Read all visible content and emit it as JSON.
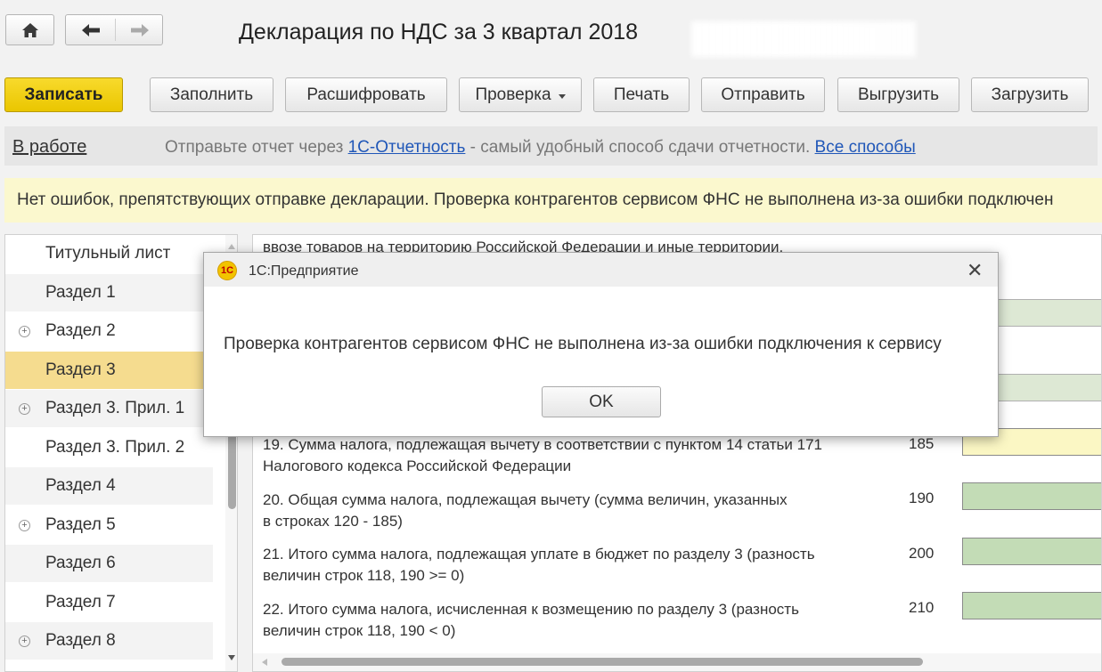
{
  "header": {
    "title": "Декларация по НДС за 3 квартал 2018"
  },
  "toolbar": {
    "save": "Записать",
    "fill": "Заполнить",
    "decode": "Расшифровать",
    "check": "Проверка",
    "print": "Печать",
    "send": "Отправить",
    "export": "Выгрузить",
    "import": "Загрузить"
  },
  "status": {
    "state_link": "В работе",
    "info_prefix": "Отправьте отчет через ",
    "info_link": "1С-Отчетность",
    "info_suffix": " - самый удобный способ сдачи отчетности. ",
    "all_methods_link": "Все способы"
  },
  "notice": {
    "text": "Нет ошибок, препятствующих отправке декларации. Проверка контрагентов сервисом ФНС не выполнена из-за ошибки подключен"
  },
  "sidebar": {
    "items": [
      {
        "label": "Титульный лист",
        "expandable": false,
        "selected": false
      },
      {
        "label": "Раздел 1",
        "expandable": false,
        "selected": false
      },
      {
        "label": "Раздел 2",
        "expandable": true,
        "selected": false
      },
      {
        "label": "Раздел 3",
        "expandable": false,
        "selected": true
      },
      {
        "label": "Раздел 3. Прил. 1",
        "expandable": true,
        "selected": false
      },
      {
        "label": "Раздел 3. Прил. 2",
        "expandable": false,
        "selected": false
      },
      {
        "label": "Раздел 4",
        "expandable": false,
        "selected": false
      },
      {
        "label": "Раздел 5",
        "expandable": true,
        "selected": false
      },
      {
        "label": "Раздел 6",
        "expandable": false,
        "selected": false
      },
      {
        "label": "Раздел 7",
        "expandable": false,
        "selected": false
      },
      {
        "label": "Раздел 8",
        "expandable": true,
        "selected": false
      }
    ]
  },
  "form": {
    "top_text": "ввозе товаров на территорию Российской Федерации и иные территории,",
    "rows": [
      {
        "line1": "19. Сумма налога, подлежащая вычету в соответствии с пунктом 14 статьи 171",
        "line2": "Налогового кодекса Российской Федерации",
        "code": "185"
      },
      {
        "line1": "20. Общая сумма налога, подлежащая вычету (сумма величин, указанных",
        "line2": "в строках 120 - 185)",
        "code": "190"
      },
      {
        "line1": "21. Итого сумма налога, подлежащая уплате в бюджет по разделу 3 (разность",
        "line2": "величин строк 118, 190 >= 0)",
        "code": "200"
      },
      {
        "line1": "22. Итого сумма налога, исчисленная к возмещению по разделу 3 (разность",
        "line2": "величин строк 118, 190 < 0)",
        "code": "210"
      }
    ]
  },
  "dialog": {
    "app_logo": "1С",
    "title": "1С:Предприятие",
    "message": "Проверка контрагентов сервисом ФНС не выполнена из-за ошибки подключения к сервису",
    "ok": "OK"
  },
  "colors": {
    "primary_button": "#f0cf0e",
    "selected_row": "#f5dc8f",
    "notice_bg": "#fbf8ce",
    "link": "#2057b8",
    "field_green": "#c3dcb6",
    "field_yellow": "#fbf7c4"
  },
  "icons": {
    "home": "home-icon",
    "back": "arrow-left-icon",
    "forward": "arrow-right-icon",
    "close": "close-icon",
    "expand": "plus-circle-icon"
  }
}
